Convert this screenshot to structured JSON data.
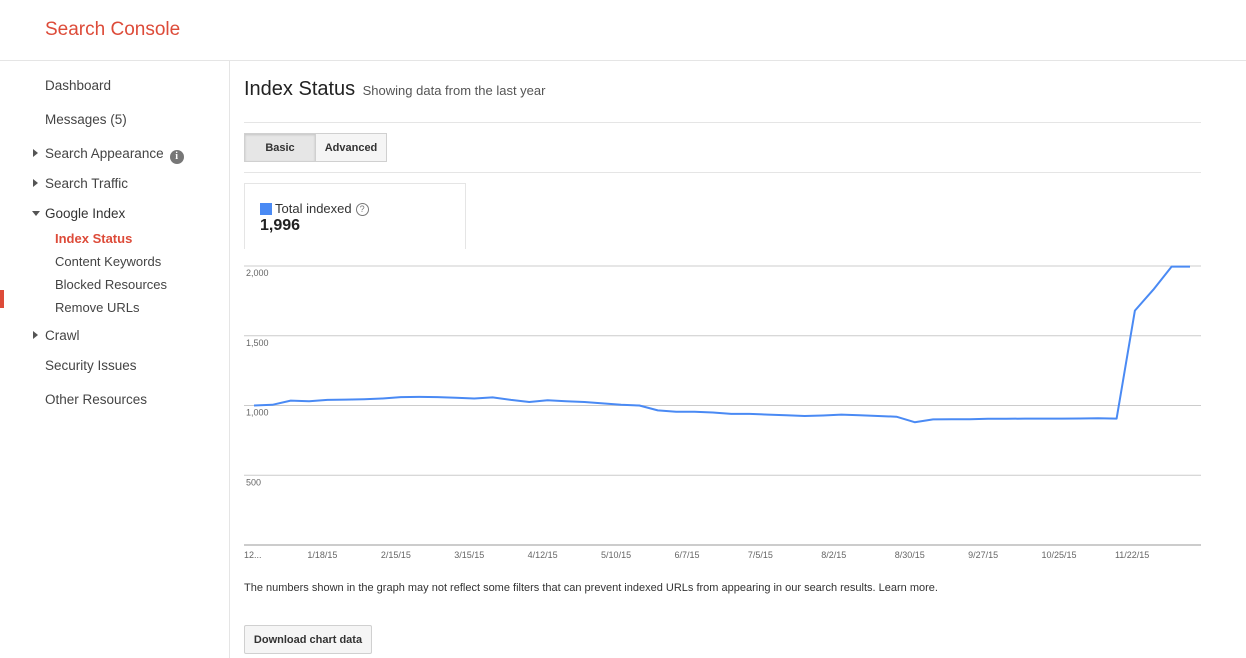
{
  "app": {
    "title": "Search Console"
  },
  "sidebar": {
    "items": [
      {
        "label": "Dashboard"
      },
      {
        "label": "Messages (5)"
      },
      {
        "label": "Search Appearance",
        "icon": "info-icon"
      },
      {
        "label": "Search Traffic"
      },
      {
        "label": "Google Index"
      },
      {
        "label": "Index Status"
      },
      {
        "label": "Content Keywords"
      },
      {
        "label": "Blocked Resources"
      },
      {
        "label": "Remove URLs"
      },
      {
        "label": "Crawl"
      },
      {
        "label": "Security Issues"
      },
      {
        "label": "Other Resources"
      }
    ],
    "active": "Index Status"
  },
  "main": {
    "title": "Index Status",
    "subtitle": "Showing data from the last year",
    "tabs": [
      {
        "label": "Basic",
        "selected": true
      },
      {
        "label": "Advanced",
        "selected": false
      }
    ],
    "metric": {
      "label": "Total indexed",
      "value": "1,996",
      "help_glyph": "?"
    },
    "footnote_text": "The numbers shown in the graph may not reflect some filters that can prevent indexed URLs from appearing in our search results.",
    "footnote_link": "Learn more.",
    "download_label": "Download chart data"
  },
  "colors": {
    "accent": "#dd4b39",
    "series": "#4a8af4",
    "grid": "#cccccc"
  },
  "chart_data": {
    "type": "line",
    "series": [
      {
        "name": "Total indexed",
        "values": [
          1000,
          1005,
          1035,
          1030,
          1040,
          1042,
          1045,
          1050,
          1060,
          1062,
          1060,
          1055,
          1050,
          1058,
          1040,
          1025,
          1038,
          1030,
          1025,
          1015,
          1005,
          1000,
          965,
          955,
          955,
          950,
          940,
          940,
          935,
          930,
          925,
          928,
          935,
          930,
          925,
          920,
          880,
          900,
          902,
          902,
          905,
          905,
          906,
          906,
          906,
          907,
          908,
          906,
          1680,
          1830,
          1996,
          1996
        ]
      }
    ],
    "x_tick_labels": [
      "12...",
      "1/18/15",
      "2/15/15",
      "3/15/15",
      "4/12/15",
      "5/10/15",
      "6/7/15",
      "7/5/15",
      "8/2/15",
      "8/30/15",
      "9/27/15",
      "10/25/15",
      "11/22/15"
    ],
    "x_tick_index": [
      0,
      4,
      8,
      12,
      16,
      20,
      24,
      28,
      32,
      36,
      40,
      44,
      48
    ],
    "y_ticks": [
      {
        "value": 2000,
        "label": "2,000"
      },
      {
        "value": 1500,
        "label": "1,500"
      },
      {
        "value": 1000,
        "label": "1,000"
      },
      {
        "value": 500,
        "label": "500"
      }
    ],
    "ylim": [
      0,
      2000
    ],
    "grid": true
  }
}
